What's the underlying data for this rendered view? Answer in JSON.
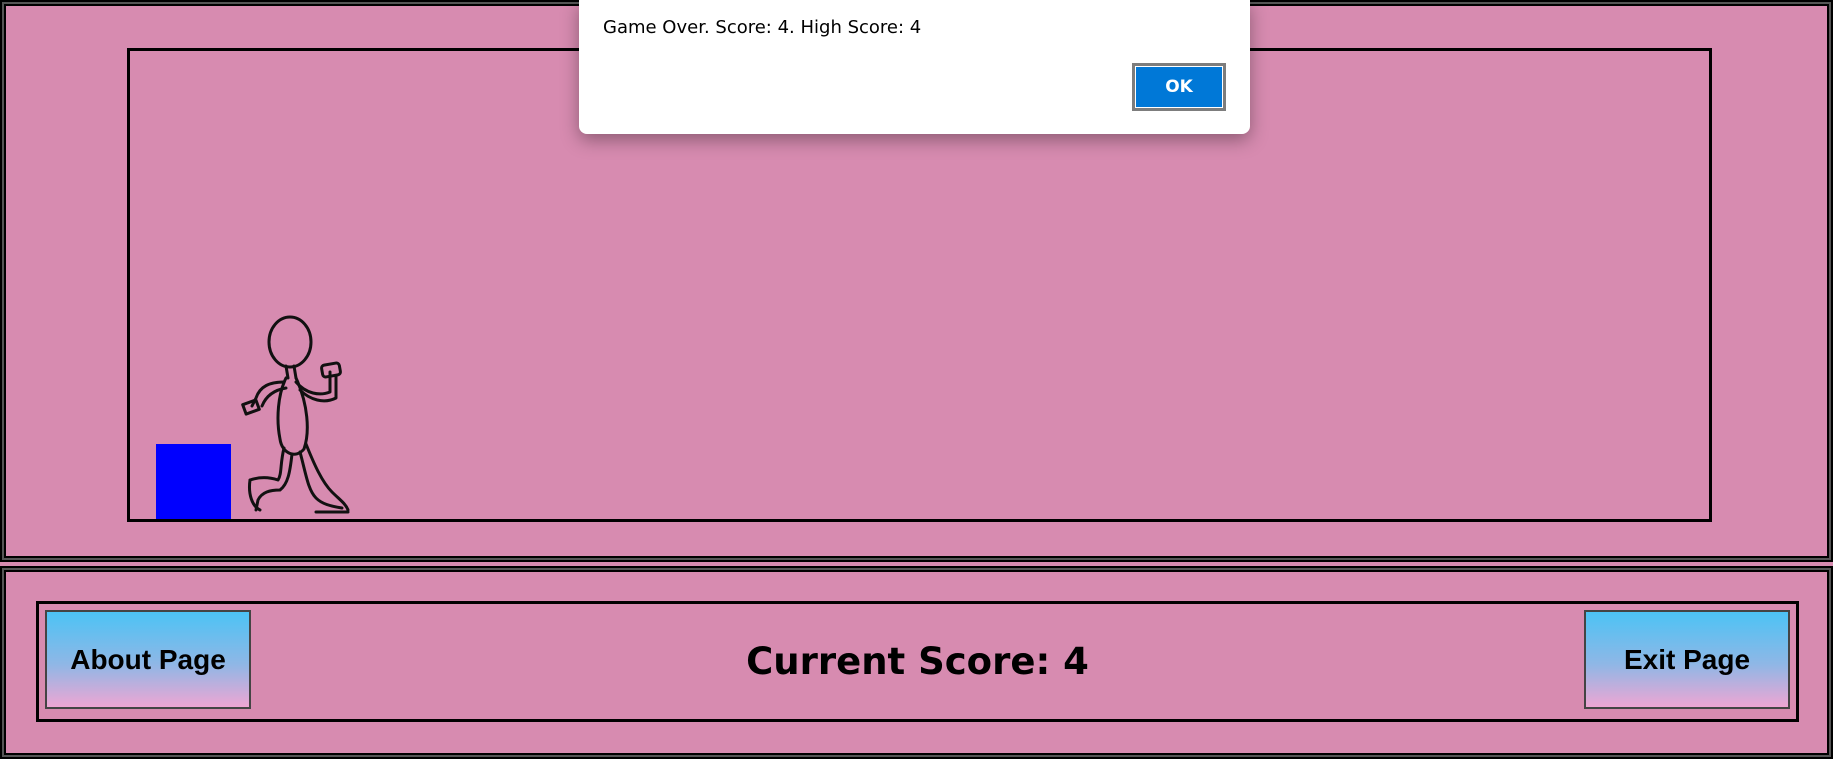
{
  "dialog": {
    "message": "Game Over. Score: 4. High Score: 4",
    "ok_label": "OK"
  },
  "game": {
    "obstacle_color": "#0000ff",
    "background_color": "#d78bb0"
  },
  "controls": {
    "about_label": "About Page",
    "exit_label": "Exit Page",
    "score_text": "Current Score: 4"
  }
}
